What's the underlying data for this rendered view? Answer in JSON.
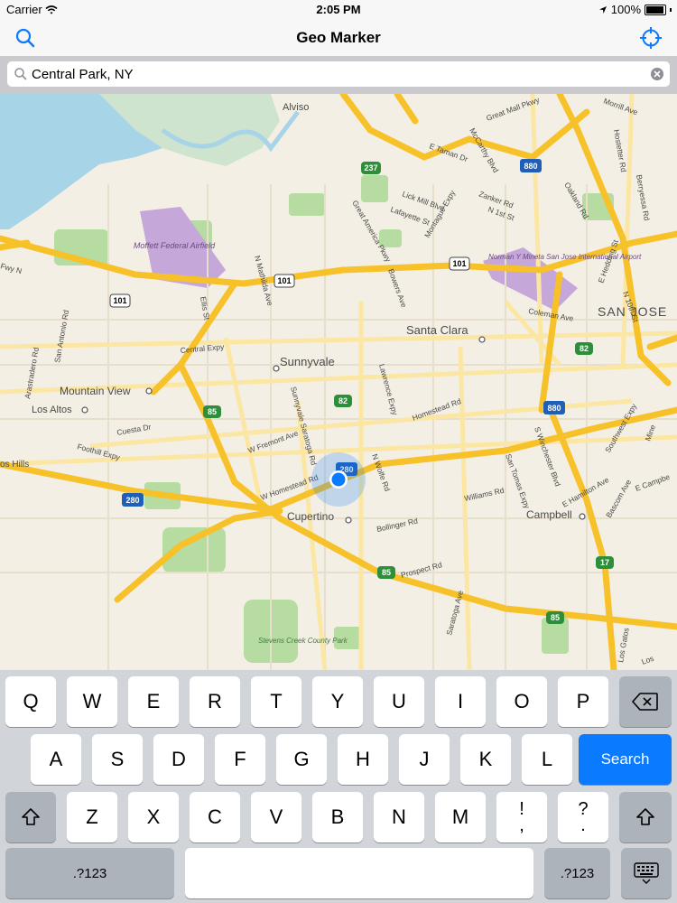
{
  "status_bar": {
    "carrier": "Carrier",
    "time": "2:05 PM",
    "battery": "100%"
  },
  "nav": {
    "title": "Geo Marker",
    "left_icon": "search-icon",
    "right_icon": "locate-icon"
  },
  "search": {
    "value": "Central Park, NY",
    "placeholder": "Search"
  },
  "map": {
    "places": [
      "Alviso",
      "Moffett Federal Airfield",
      "Santa Clara",
      "Sunnyvale",
      "Mountain View",
      "Los Altos",
      "Cupertino",
      "Campbell",
      "SAN JOSE",
      "Norman Y Mineta San Jose International Airport",
      "Stevens Creek County Park",
      "os Hills"
    ],
    "streets": [
      "Great America Pkwy",
      "Lick Mill Blvd",
      "Lafayette St",
      "Montague Expy",
      "Zanker Rd",
      "N 1st St",
      "E Taman Dr",
      "McCarthy Blvd",
      "Great Mall Pkwy",
      "Oakland Rd",
      "Hostetter Rd",
      "Berryessa Rd",
      "Morrill Ave",
      "Bowers Ave",
      "N Mathilda Ave",
      "Ellis St",
      "Central Expy",
      "San Antonio Rd",
      "Arastradero Rd",
      "Cuesta Dr",
      "Foothill Expy",
      "Lawrence Expy",
      "Homestead Rd",
      "Sunnyvale Saratoga Rd",
      "W Fremont Ave",
      "W Homestead Rd",
      "N Wolfe Rd",
      "Williams Rd",
      "San Tomas Expy",
      "S Winchester Blvd",
      "Bollinger Rd",
      "Prospect Rd",
      "Saratoga Ave",
      "E Hamilton Ave",
      "Bascom Ave",
      "Southwest Expy",
      "Coleman Ave",
      "E Hedding St",
      "N 10th St",
      "Fwy N",
      "E Campbe",
      "Los Gatos",
      "Mine",
      "Los"
    ],
    "shields": [
      "101",
      "237",
      "880",
      "82",
      "85",
      "280",
      "17"
    ],
    "location_marker": "current-location-dot"
  },
  "keyboard": {
    "row1": [
      "Q",
      "W",
      "E",
      "R",
      "T",
      "Y",
      "U",
      "I",
      "O",
      "P"
    ],
    "row2": [
      "A",
      "S",
      "D",
      "F",
      "G",
      "H",
      "J",
      "K",
      "L"
    ],
    "row3": [
      "Z",
      "X",
      "C",
      "V",
      "B",
      "N",
      "M"
    ],
    "punct1": {
      "top": "!",
      "bottom": ","
    },
    "punct2": {
      "top": "?",
      "bottom": "."
    },
    "search_label": "Search",
    "numbers_label": ".?123",
    "icons": {
      "delete": "backspace-icon",
      "shift": "shift-icon",
      "dismiss": "keyboard-dismiss-icon"
    }
  },
  "colors": {
    "accent": "#0a7aff",
    "road": "#f7c12a",
    "water": "#a8d4e7",
    "park": "#b6dca2",
    "airport": "#c6a7d9"
  }
}
